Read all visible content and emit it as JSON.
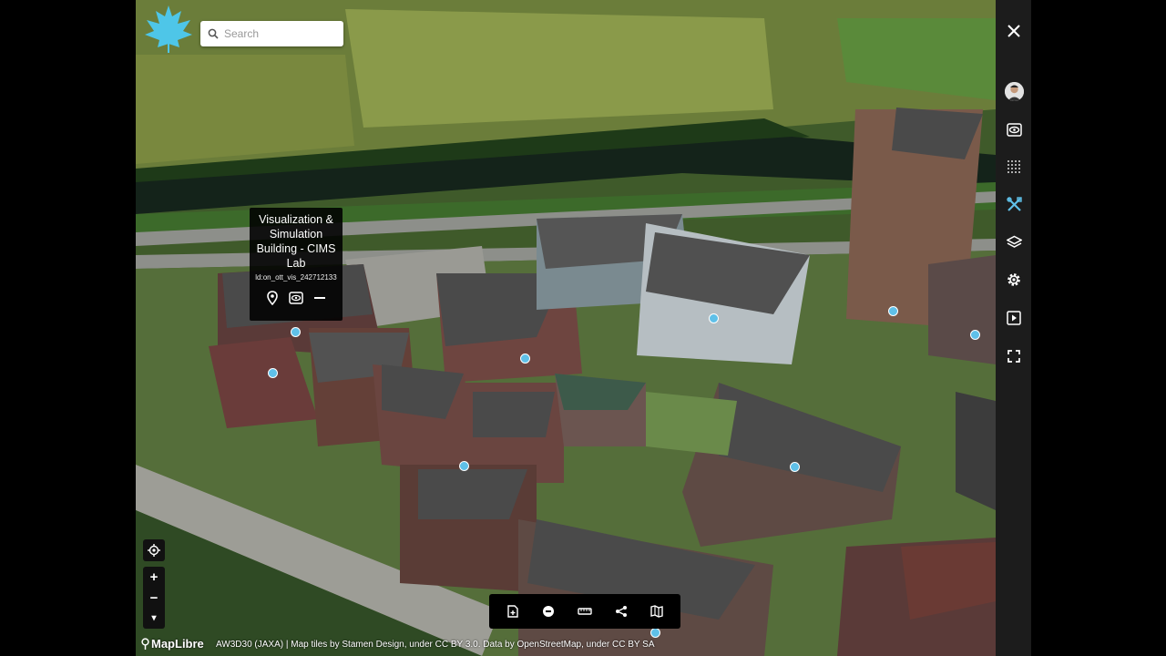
{
  "search": {
    "placeholder": "Search"
  },
  "popup": {
    "title": "Visualization & Simulation Building - CIMS Lab",
    "id": "ld:on_ott_vis_242712133"
  },
  "map_controls": {
    "zoom_in": "+",
    "zoom_out": "−",
    "pitch": "▾"
  },
  "brand": "MapLibre",
  "attribution": "AW3D30 (JAXA) | Map tiles by Stamen Design, under CC BY 3.0. Data by OpenStreetMap, under CC BY SA",
  "toolbar": [
    "new-file-icon",
    "minus-circle-icon",
    "ruler-icon",
    "share-icon",
    "map-icon"
  ],
  "sidebar": [
    "close-icon",
    "user-avatar",
    "eye-icon",
    "grid-dots-icon",
    "tools-icon",
    "layers-icon",
    "settings-icon",
    "play-icon",
    "fullscreen-icon"
  ],
  "colors": {
    "accent": "#5fc0e8",
    "sidebar": "#1c1c1c",
    "panel": "#000000"
  }
}
